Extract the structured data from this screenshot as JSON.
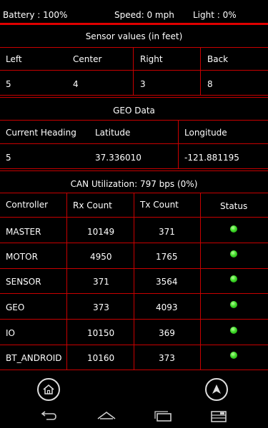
{
  "status_bar": {
    "battery": "Battery : 100%",
    "speed": "Speed: 0 mph",
    "light": "Light : 0%"
  },
  "sensors": {
    "title": "Sensor values (in feet)",
    "headers": [
      "Left",
      "Center",
      "Right",
      "Back"
    ],
    "values": [
      "5",
      "4",
      "3",
      "8"
    ]
  },
  "geo": {
    "title": "GEO Data",
    "headers": [
      "Current Heading",
      "Latitude",
      "Longitude"
    ],
    "values": [
      "5",
      "37.336010",
      "-121.881195"
    ]
  },
  "can": {
    "title": "CAN Utilization: 797 bps (0%)",
    "headers": [
      "Controller",
      "Rx Count",
      "Tx Count",
      "Status"
    ],
    "rows": [
      {
        "controller": "MASTER",
        "rx": "10149",
        "tx": "371"
      },
      {
        "controller": "MOTOR",
        "rx": "4950",
        "tx": "1765"
      },
      {
        "controller": "SENSOR",
        "rx": "371",
        "tx": "3564"
      },
      {
        "controller": "GEO",
        "rx": "373",
        "tx": "4093"
      },
      {
        "controller": "IO",
        "rx": "10150",
        "tx": "369"
      },
      {
        "controller": "BT_ANDROID",
        "rx": "10160",
        "tx": "373"
      }
    ],
    "status_color": "#3fdc28"
  },
  "colors": {
    "accent": "#e00000",
    "background": "#000000"
  },
  "icons": {
    "home": "home-icon",
    "navigate": "navigation-arrow-icon",
    "back": "back-icon",
    "home_sys": "home-icon",
    "recents": "recents-icon",
    "menu": "menu-icon"
  }
}
